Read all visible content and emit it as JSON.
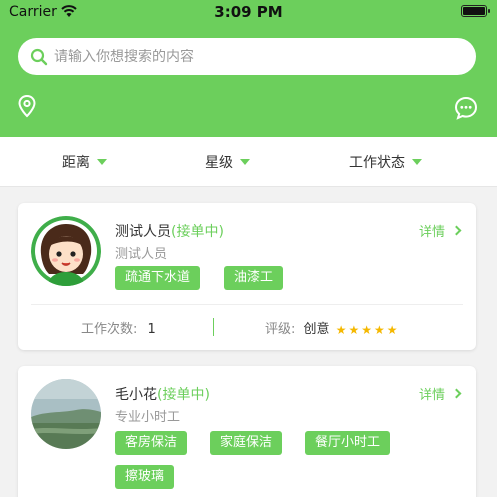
{
  "statusbar": {
    "carrier": "Carrier",
    "time": "3:09 PM"
  },
  "search": {
    "placeholder": "请输入你想搜索的内容"
  },
  "filters": [
    {
      "label": "距离"
    },
    {
      "label": "星级"
    },
    {
      "label": "工作状态"
    }
  ],
  "colors": {
    "accent": "#6ccf5c",
    "star": "#f5b800"
  },
  "workers": [
    {
      "name": "测试人员",
      "status": "(接单中)",
      "title": "测试人员",
      "detail_label": "详情",
      "tags": [
        "疏通下水道",
        "油漆工"
      ],
      "work_count_label": "工作次数:",
      "work_count": "1",
      "rating_label": "评级:",
      "rating_text": "创意",
      "rating_stars": 5
    },
    {
      "name": "毛小花",
      "status": "(接单中)",
      "title": "专业小时工",
      "detail_label": "详情",
      "tags": [
        "客房保洁",
        "家庭保洁",
        "餐厅小时工",
        "擦玻璃"
      ]
    }
  ]
}
